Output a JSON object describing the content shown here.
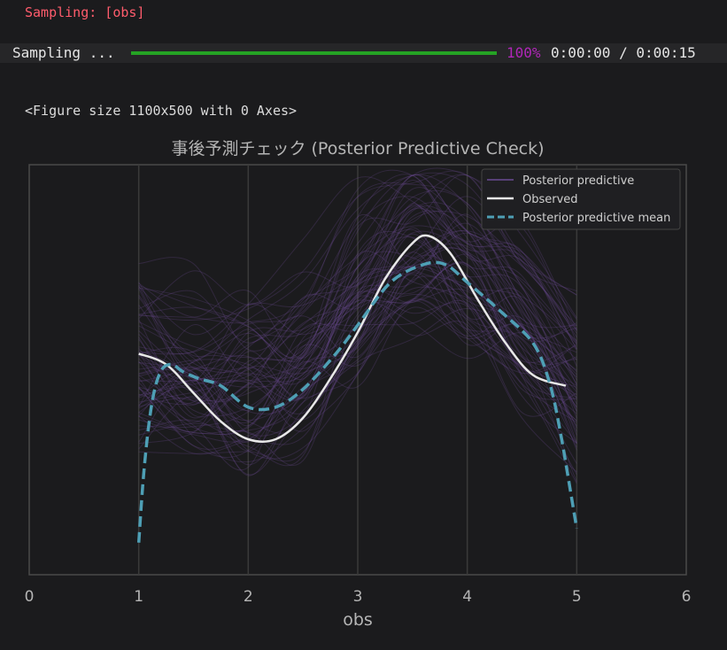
{
  "output": {
    "stderr_text": "Sampling: [obs]",
    "progress": {
      "label": "Sampling ...",
      "fraction": 1.0,
      "percent_text": "100%",
      "time_text": "0:00:00 / 0:00:15",
      "bar_color": "#25a324",
      "percent_color": "#b026b8"
    },
    "figure_repr": "<Figure size 1100x500 with 0 Axes>"
  },
  "chart_data": {
    "type": "line",
    "title": "事後予測チェック (Posterior Predictive Check)",
    "xlabel": "obs",
    "ylabel": "",
    "xlim": [
      0,
      6
    ],
    "xticks": [
      "0",
      "1",
      "2",
      "3",
      "4",
      "5",
      "6"
    ],
    "grid": true,
    "legend_position": "top-right",
    "series": [
      {
        "name": "Posterior predictive",
        "color": "#6a4c93",
        "x": [
          1.0,
          1.5,
          2.0,
          2.5,
          3.0,
          3.5,
          4.0,
          4.5,
          5.0
        ],
        "y": [
          0.62,
          0.58,
          0.55,
          0.63,
          0.8,
          0.95,
          0.9,
          0.72,
          0.55
        ]
      },
      {
        "name": "Observed",
        "color": "#e8e8e8",
        "x": [
          1.0,
          1.25,
          1.5,
          1.75,
          2.0,
          2.25,
          2.5,
          2.75,
          3.0,
          3.25,
          3.5,
          3.65,
          3.85,
          4.1,
          4.35,
          4.6,
          4.9
        ],
        "y": [
          0.62,
          0.59,
          0.51,
          0.43,
          0.38,
          0.38,
          0.44,
          0.55,
          0.68,
          0.83,
          0.93,
          0.95,
          0.9,
          0.77,
          0.65,
          0.56,
          0.53
        ]
      },
      {
        "name": "Posterior predictive mean",
        "color": "#4e9fb5",
        "x": [
          1.0,
          1.05,
          1.12,
          1.2,
          1.3,
          1.4,
          1.55,
          1.75,
          2.0,
          2.25,
          2.5,
          2.8,
          3.0,
          3.3,
          3.6,
          3.8,
          4.0,
          4.3,
          4.6,
          4.75,
          4.85,
          4.95,
          5.0
        ],
        "y": [
          0.09,
          0.3,
          0.48,
          0.57,
          0.59,
          0.57,
          0.55,
          0.53,
          0.47,
          0.47,
          0.52,
          0.62,
          0.7,
          0.82,
          0.87,
          0.87,
          0.82,
          0.74,
          0.65,
          0.54,
          0.4,
          0.22,
          0.13
        ]
      }
    ]
  },
  "style": {
    "background": "#1b1b1d",
    "axes_edge": "#4a4a4a",
    "grid_color": "#3a3a3a",
    "title_color": "#b5b5b5",
    "tick_color": "#b5b5b5"
  }
}
